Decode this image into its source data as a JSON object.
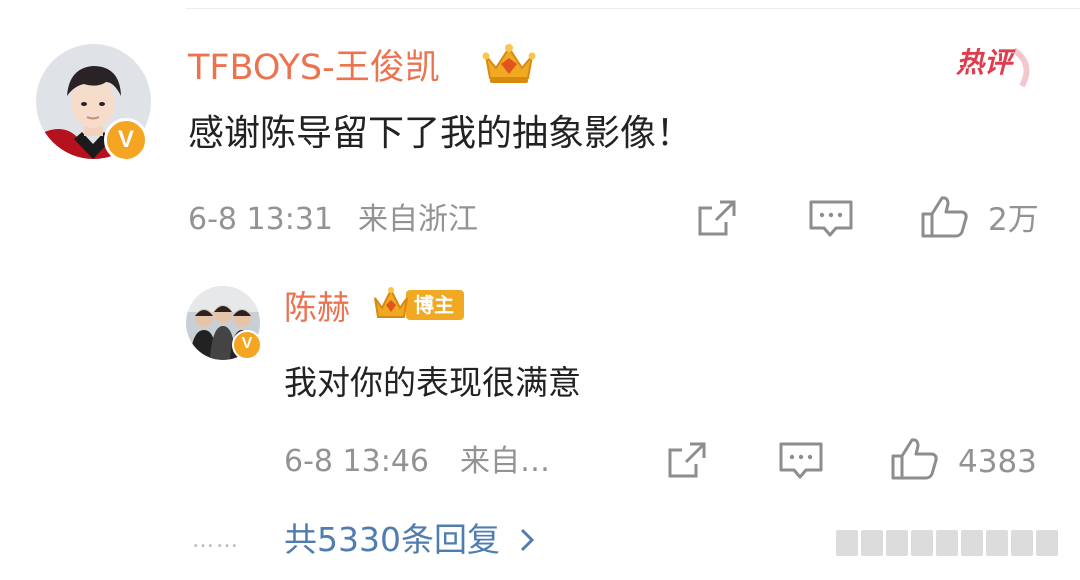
{
  "comment": {
    "author": "TFBOYS-王俊凯",
    "badge_label": "热评",
    "text": "感谢陈导留下了我的抽象影像！",
    "time": "6-8 13:31",
    "location": "来自浙江",
    "likes": "2万",
    "verified_mark": "V"
  },
  "reply": {
    "author": "陈赫",
    "role_tag": "博主",
    "text": "我对你的表现很满意",
    "time": "6-8 13:46",
    "location": "来自…",
    "likes": "4383",
    "verified_mark": "V"
  },
  "footer": {
    "dots": "……",
    "more_replies": "共5330条回复"
  },
  "icons": {
    "share": "share-icon",
    "comment": "comment-icon",
    "like": "thumbs-up-icon",
    "chevron": "chevron-right-icon",
    "crown": "crown-icon"
  },
  "colors": {
    "name": "#eb7350",
    "link": "#507daf",
    "meta": "#939393",
    "hot": "#e03c4e",
    "gold": "#f2a922"
  }
}
